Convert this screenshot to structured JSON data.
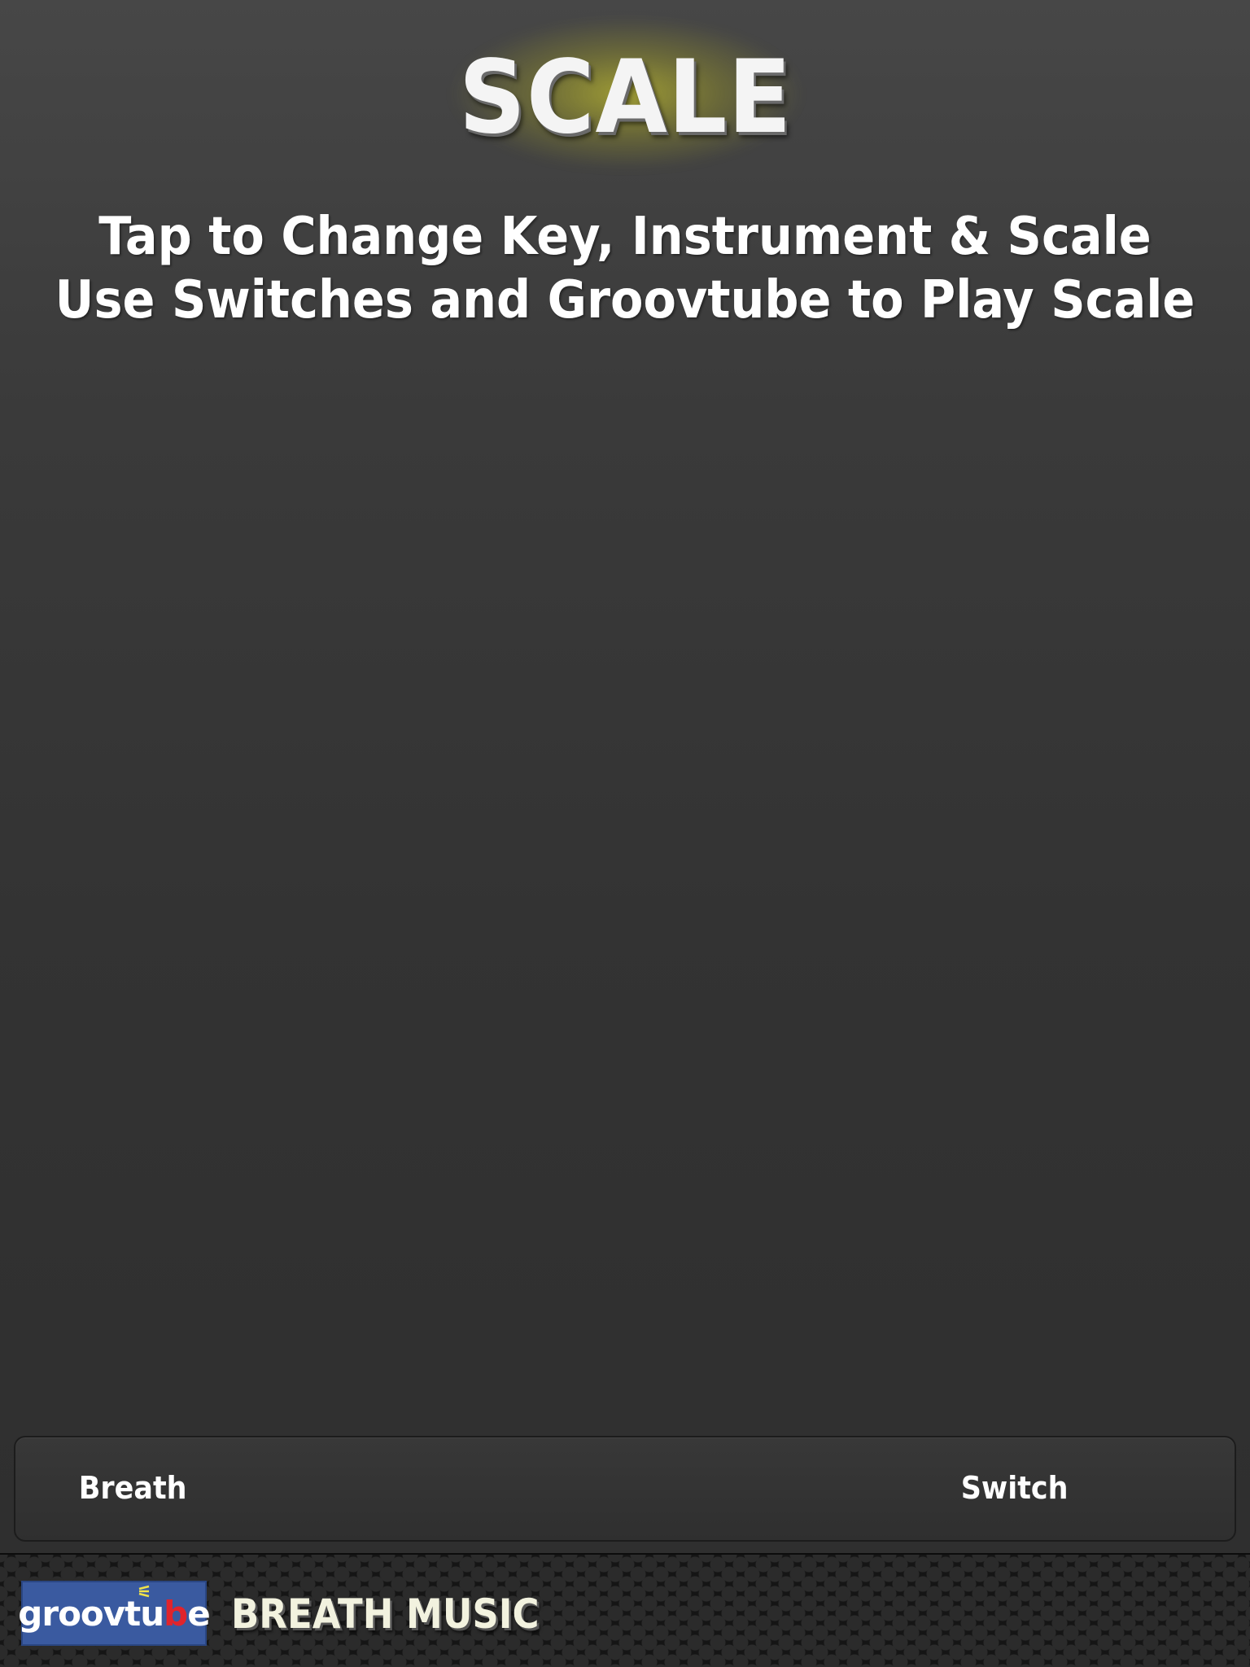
{
  "header": {
    "title": "SCALE"
  },
  "instructions": {
    "line1": "Tap to Change Key, Instrument & Scale",
    "line2": "Use Switches and  Groovtube to Play Scale"
  },
  "controls": {
    "breath_label": "Breath",
    "switch_label": "Switch"
  },
  "footer": {
    "logo_prefix": "groovtu",
    "logo_b": "b",
    "logo_suffix": "e",
    "brand_name": "BREATH MUSIC"
  },
  "colors": {
    "background": "#333333",
    "title_glow": "#e6e028",
    "logo_background": "#3a5aa0",
    "logo_accent": "#e0242c"
  }
}
